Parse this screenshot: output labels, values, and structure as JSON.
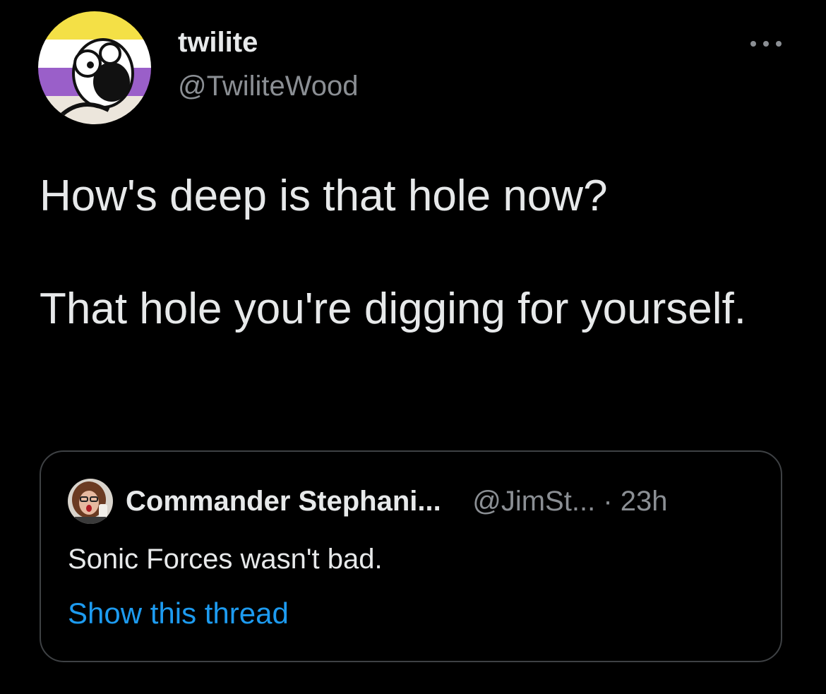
{
  "tweet": {
    "author": {
      "display_name": "twilite",
      "handle": "@TwiliteWood",
      "avatar_icon": "cartoon-character-avatar-icon",
      "avatar_colors": [
        "#f4e046",
        "#ffffff",
        "#9a5fc9",
        "#2b2b2b"
      ]
    },
    "more_icon": "ellipsis-icon",
    "text": "How's deep is that hole now?\n\nThat hole you're digging for yourself.",
    "quote": {
      "display_name": "Commander Stephani...",
      "handle": "@JimSt...",
      "separator": "·",
      "time": "23h",
      "text": "Sonic Forces wasn't bad.",
      "show_thread_label": "Show this thread",
      "avatar_icon": "user-photo-avatar-icon"
    }
  },
  "colors": {
    "background": "#000000",
    "primary_text": "#e7e9ea",
    "secondary_text": "#8b8f94",
    "link": "#1d9bf0",
    "border": "#3e4144"
  }
}
